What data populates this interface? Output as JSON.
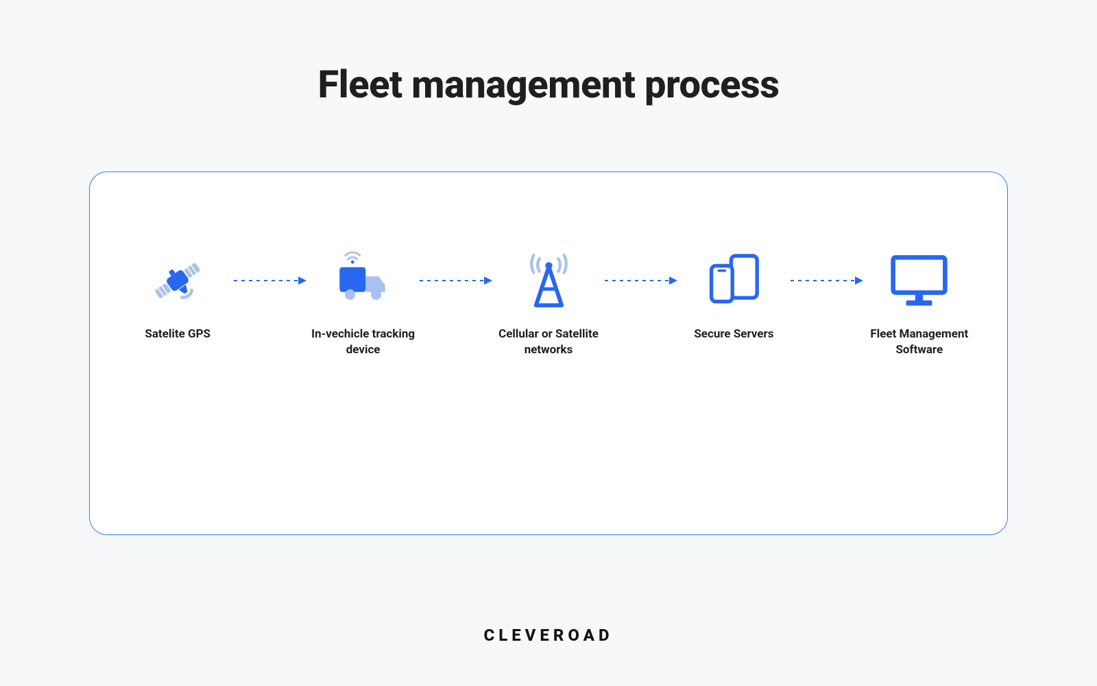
{
  "title": "Fleet management process",
  "steps": [
    {
      "label": "Satelite GPS"
    },
    {
      "label": "In-vechicle tracking device"
    },
    {
      "label": "Cellular or Satellite networks"
    },
    {
      "label": "Secure Servers"
    },
    {
      "label": "Fleet Management Software"
    }
  ],
  "brand": "CLEVEROAD",
  "colors": {
    "primary": "#2867F0",
    "primaryLight": "#A8C1EE",
    "border": "#2E7BFA",
    "bg": "#F7F8FA",
    "text": "#1F1F1F"
  }
}
